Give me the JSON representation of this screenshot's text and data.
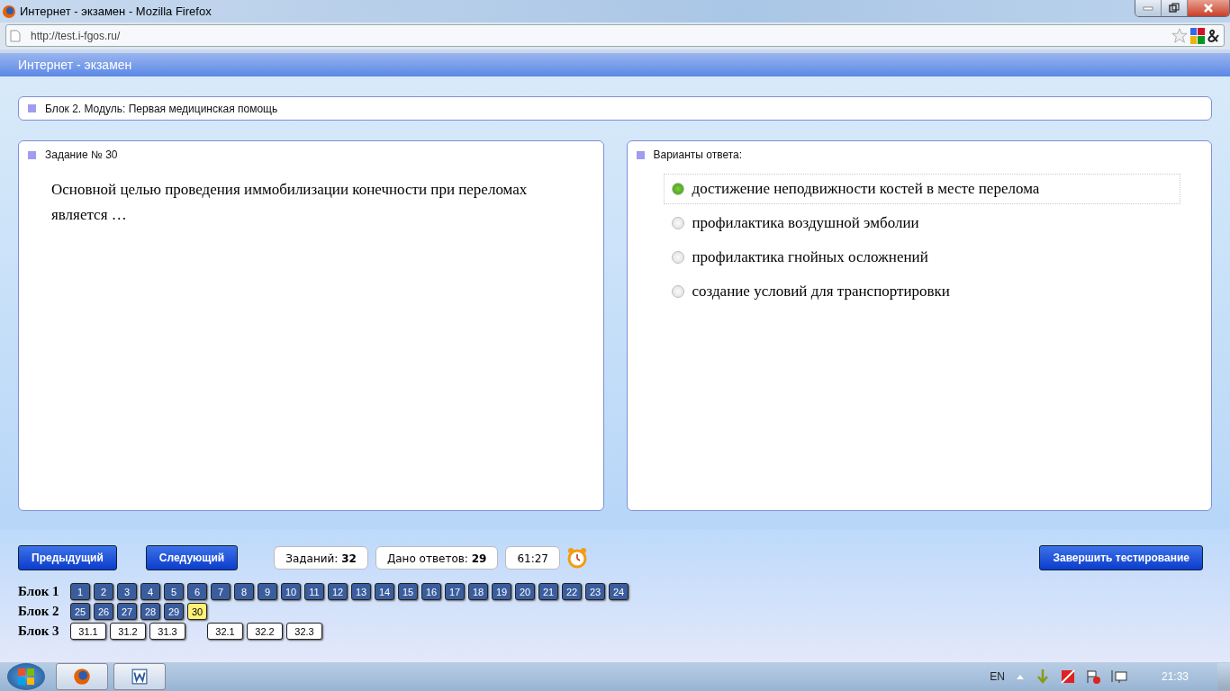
{
  "window": {
    "title": "Интернет - экзамен - Mozilla Firefox"
  },
  "address_bar": {
    "url": "http://test.i-fgos.ru/"
  },
  "app_header": {
    "title": "Интернет - экзамен"
  },
  "block_panel": {
    "label": "Блок 2. Модуль: Первая медицинская помощь"
  },
  "task_panel": {
    "label": "Задание № 30",
    "question": "Основной целью проведения иммобилизации конечности при переломах является …"
  },
  "answers_panel": {
    "label": "Варианты ответа:",
    "options": [
      {
        "text": "достижение неподвижности костей в месте перелома",
        "selected": true
      },
      {
        "text": "профилактика воздушной эмболии",
        "selected": false
      },
      {
        "text": "профилактика гнойных осложнений",
        "selected": false
      },
      {
        "text": "создание условий для транспортировки",
        "selected": false
      }
    ]
  },
  "controls": {
    "prev": "Предыдущий",
    "next": "Следующий",
    "stats": [
      "Заданий: **32**",
      "Дано ответов: **29**"
    ],
    "timer": "61:27",
    "finish": "Завершить тестирование"
  },
  "blocks": [
    {
      "label": "Блок 1",
      "groups": [
        [
          {
            "n": "1",
            "answered": true,
            "selected": false
          },
          {
            "n": "2",
            "answered": true,
            "selected": false
          },
          {
            "n": "3",
            "answered": true,
            "selected": false
          },
          {
            "n": "4",
            "answered": true,
            "selected": false
          },
          {
            "n": "5",
            "answered": true,
            "selected": false
          },
          {
            "n": "6",
            "answered": true,
            "selected": false
          },
          {
            "n": "7",
            "answered": true,
            "selected": false
          },
          {
            "n": "8",
            "answered": true,
            "selected": false
          },
          {
            "n": "9",
            "answered": true,
            "selected": false
          },
          {
            "n": "10",
            "answered": true,
            "selected": false
          },
          {
            "n": "11",
            "answered": true,
            "selected": false
          },
          {
            "n": "12",
            "answered": true,
            "selected": false
          },
          {
            "n": "13",
            "answered": true,
            "selected": false
          },
          {
            "n": "14",
            "answered": true,
            "selected": false
          },
          {
            "n": "15",
            "answered": true,
            "selected": false
          },
          {
            "n": "16",
            "answered": true,
            "selected": false
          },
          {
            "n": "17",
            "answered": true,
            "selected": false
          },
          {
            "n": "18",
            "answered": true,
            "selected": false
          },
          {
            "n": "19",
            "answered": true,
            "selected": false
          },
          {
            "n": "20",
            "answered": true,
            "selected": false
          },
          {
            "n": "21",
            "answered": true,
            "selected": false
          },
          {
            "n": "22",
            "answered": true,
            "selected": false
          },
          {
            "n": "23",
            "answered": true,
            "selected": false
          },
          {
            "n": "24",
            "answered": true,
            "selected": false
          }
        ]
      ]
    },
    {
      "label": "Блок 2",
      "groups": [
        [
          {
            "n": "25",
            "answered": true,
            "selected": false
          },
          {
            "n": "26",
            "answered": true,
            "selected": false
          },
          {
            "n": "27",
            "answered": true,
            "selected": false
          },
          {
            "n": "28",
            "answered": true,
            "selected": false
          },
          {
            "n": "29",
            "answered": true,
            "selected": false
          },
          {
            "n": "30",
            "answered": false,
            "selected": true
          }
        ]
      ]
    },
    {
      "label": "Блок 3",
      "groups": [
        [
          {
            "n": "31.1",
            "answered": false,
            "selected": false
          },
          {
            "n": "31.2",
            "answered": false,
            "selected": false
          },
          {
            "n": "31.3",
            "answered": false,
            "selected": false
          }
        ],
        [
          {
            "n": "32.1",
            "answered": false,
            "selected": false
          },
          {
            "n": "32.2",
            "answered": false,
            "selected": false
          },
          {
            "n": "32.3",
            "answered": false,
            "selected": false
          }
        ]
      ]
    }
  ],
  "taskbar": {
    "language": "EN",
    "clock": "21:33"
  }
}
